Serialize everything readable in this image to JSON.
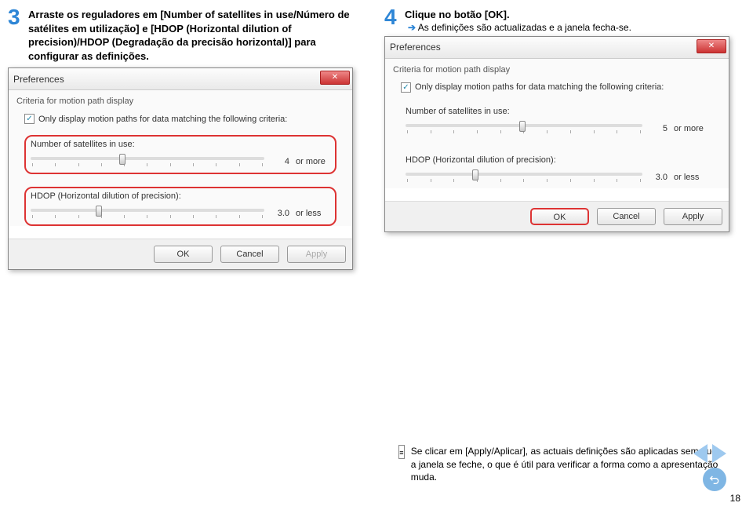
{
  "step3": {
    "num": "3",
    "text": "Arraste os reguladores em [Number of satellites in use/Número de satélites em utilização] e [HDOP (Horizontal dilution of precision)/HDOP (Degradação da precisão horizontal)] para configurar as definições."
  },
  "step4": {
    "num": "4",
    "title": "Clique no botão [OK].",
    "arrow_text": "As definições são actualizadas e a janela fecha-se."
  },
  "dialog": {
    "title": "Preferences",
    "close_glyph": "✕",
    "criteria": "Criteria for motion path display",
    "checkbox_checked": "✓",
    "checkbox_label": "Only display motion paths for data matching the following criteria:",
    "slider1": {
      "label": "Number of satellites in use:",
      "suffix": "or more"
    },
    "slider2": {
      "label": "HDOP (Horizontal dilution of precision):",
      "suffix": "or less"
    },
    "buttons": {
      "ok": "OK",
      "cancel": "Cancel",
      "apply": "Apply"
    }
  },
  "left_dialog": {
    "slider1_value": "4",
    "slider2_value": "3.0"
  },
  "right_dialog": {
    "slider1_value": "5",
    "slider2_value": "3.0"
  },
  "note": {
    "text": "Se clicar em [Apply/Aplicar], as actuais definições são aplicadas sem que a janela se feche, o que é útil para verificar a forma como a apresentação muda."
  },
  "page_number": "18"
}
